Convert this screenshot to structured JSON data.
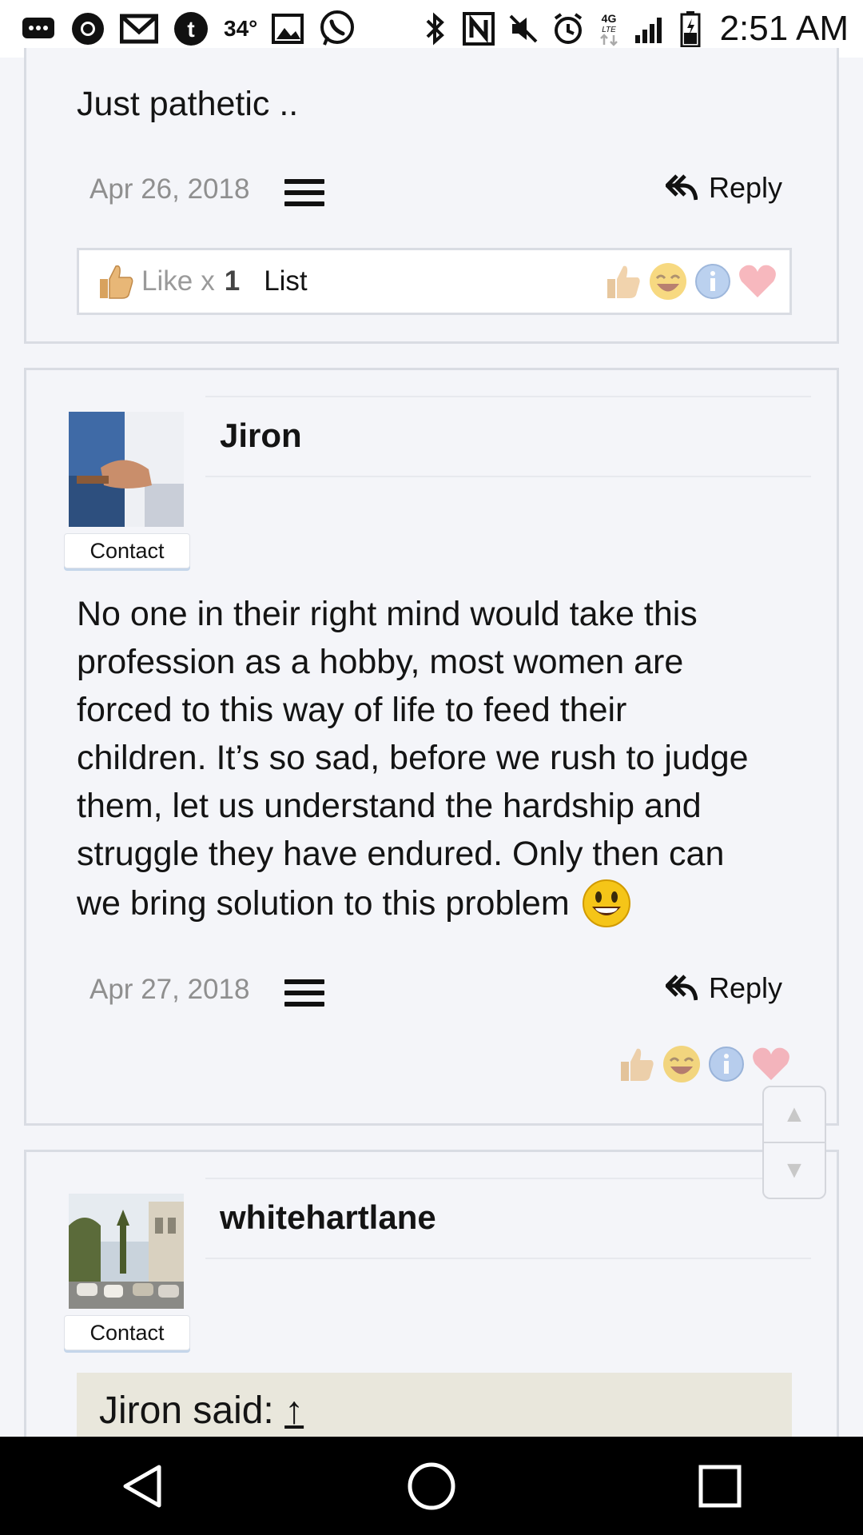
{
  "status_bar": {
    "temperature": "34°",
    "time": "2:51 AM",
    "network_type": "4G LTE",
    "left_icons": [
      "messages-icon",
      "chrome-icon",
      "gmail-icon",
      "tumblr-icon",
      "temperature",
      "gallery-icon",
      "whatsapp-icon"
    ],
    "right_icons": [
      "bluetooth-icon",
      "nfc-icon",
      "mute-icon",
      "alarm-icon",
      "network-4g-icon",
      "signal-icon",
      "battery-icon"
    ]
  },
  "posts": [
    {
      "body": "Just pathetic ..",
      "date": "Apr 26, 2018",
      "reply_label": "Reply",
      "reactions": {
        "like_label": "Like",
        "like_multiplier": "x",
        "like_count": "1",
        "list_label": "List"
      }
    },
    {
      "author": "Jiron",
      "contact_label": "Contact",
      "body_lines": [
        "No one in their right mind would take this",
        "profession as a hobby, most women are",
        "forced to this way of life to feed their",
        "children. It’s so sad, before we rush to judge",
        "them, let us understand the hardship and",
        "struggle they have endured. Only then can",
        "we bring solution to this problem"
      ],
      "date": "Apr 27, 2018",
      "reply_label": "Reply"
    },
    {
      "author": "whitehartlane",
      "contact_label": "Contact",
      "quote_prefix": "Jiron said:",
      "quote_arrow": "↑"
    }
  ],
  "scroll_buttons": {
    "up": "▲",
    "down": "▼"
  },
  "reaction_icons": [
    "thumbs-up-icon",
    "laughing-icon",
    "info-icon",
    "heart-icon"
  ],
  "colors": {
    "background": "#f4f5f9",
    "border": "#d9dce3",
    "date_gray": "#8f8f8f",
    "quote_bg": "#e9e7dc"
  }
}
